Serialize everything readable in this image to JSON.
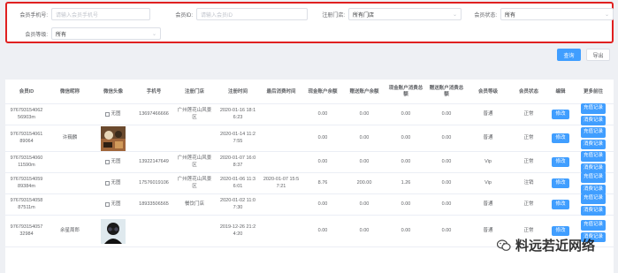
{
  "filters": {
    "phone": {
      "label": "会员手机号:",
      "placeholder": "请输入会员手机号"
    },
    "member_id": {
      "label": "会员ID:",
      "placeholder": "请输入会员ID"
    },
    "store": {
      "label": "注册门店:",
      "value": "所有门店"
    },
    "status": {
      "label": "会员状态:",
      "value": "所有"
    },
    "level": {
      "label": "会员等级:",
      "value": "所有"
    }
  },
  "actions": {
    "query": "查询",
    "export": "导出"
  },
  "table": {
    "headers": {
      "id": "会员ID",
      "nick": "微信昵称",
      "avatar": "微信头像",
      "phone": "手机号",
      "store": "注册门店",
      "reg_time": "注册时间",
      "last_time": "最后消费时间",
      "cash": "现金账户余额",
      "gift": "赠送账户余额",
      "cash_total": "现金账户消费总额",
      "gift_total": "赠送账户消费总额",
      "level": "会员等级",
      "status": "会员状态",
      "edit": "编辑",
      "more": "更多前往"
    },
    "buttons": {
      "edit": "修改",
      "recharge": "充值记录",
      "consume": "消费记录",
      "no_image": "无图"
    },
    "rows": [
      {
        "id": "976793154062\n56903m",
        "nick": "",
        "avatar": "none",
        "phone": "13697466666",
        "store": "广州莲花山风景\n区",
        "reg_time": "2020-01-16 18:1\n6:23",
        "last_time": "",
        "cash": "0.00",
        "gift": "0.00",
        "cash_total": "0.00",
        "gift_total": "0.00",
        "level": "普通",
        "status": "正常"
      },
      {
        "id": "976793154061\n89064",
        "nick": "许巍麟",
        "avatar": "photo",
        "phone": "",
        "store": "",
        "reg_time": "2020-01-14 11:2\n7:55",
        "last_time": "",
        "cash": "0.00",
        "gift": "0.00",
        "cash_total": "0.00",
        "gift_total": "0.00",
        "level": "普通",
        "status": "正常"
      },
      {
        "id": "976793154060\n11590m",
        "nick": "",
        "avatar": "none",
        "phone": "13922147649",
        "store": "广州莲花山风景\n区",
        "reg_time": "2020-01-07 16:0\n8:37",
        "last_time": "",
        "cash": "0.00",
        "gift": "0.00",
        "cash_total": "0.00",
        "gift_total": "0.00",
        "level": "Vip",
        "status": "正常"
      },
      {
        "id": "976793154059\n89384m",
        "nick": "",
        "avatar": "none",
        "phone": "17576019106",
        "store": "广州莲花山风景\n区",
        "reg_time": "2020-01-06 11:3\n6:01",
        "last_time": "2020-01-07 15:5\n7:21",
        "cash": "8.76",
        "gift": "200.00",
        "cash_total": "1.26",
        "gift_total": "0.00",
        "level": "Vip",
        "status": "注销"
      },
      {
        "id": "976793154058\n87511m",
        "nick": "",
        "avatar": "none",
        "phone": "18933506565",
        "store": "餐饮门店",
        "reg_time": "2020-01-02 11:0\n7:30",
        "last_time": "",
        "cash": "0.00",
        "gift": "0.00",
        "cash_total": "0.00",
        "gift_total": "0.00",
        "level": "普通",
        "status": "正常"
      },
      {
        "id": "976793154057\n32984",
        "nick": "余星周郎",
        "avatar": "photo2",
        "phone": "",
        "store": "",
        "reg_time": "2019-12-26 21:2\n4:20",
        "last_time": "",
        "cash": "0.00",
        "gift": "0.00",
        "cash_total": "0.00",
        "gift_total": "0.00",
        "level": "普通",
        "status": "正常"
      }
    ]
  },
  "watermark": "料远若近网络",
  "colors": {
    "accent": "#409eff",
    "highlight_border": "#e02020"
  }
}
